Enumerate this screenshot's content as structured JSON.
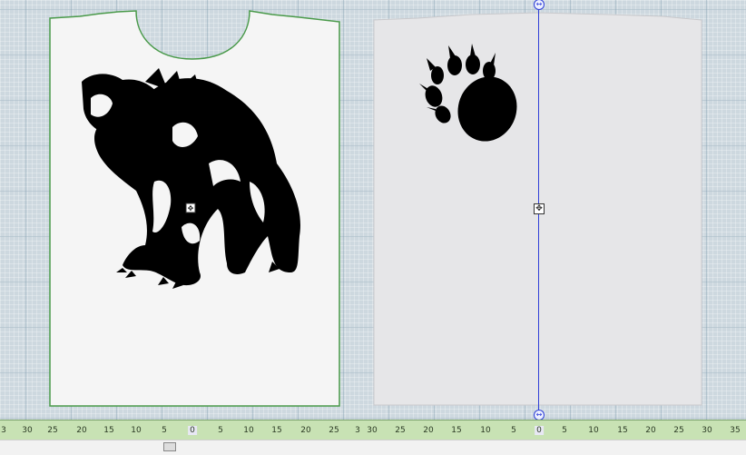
{
  "ruler": {
    "labels": [
      "3",
      "30",
      "25",
      "20",
      "15",
      "10",
      "5",
      "0",
      "5",
      "10",
      "15",
      "20",
      "25",
      "3",
      "30",
      "25",
      "20",
      "15",
      "10",
      "5",
      "0",
      "5",
      "10",
      "15",
      "20",
      "25",
      "30",
      "35"
    ]
  },
  "colors": {
    "front_fill": "#f5f5f5",
    "front_outline": "#4a9a4a",
    "back_fill": "#e6e6e8",
    "guide_line": "#2f3fd8",
    "ruler_bg": "#c8e2b4",
    "motif": "#000000"
  },
  "icons": {
    "bear": "roaring-bear-motif",
    "paw": "bear-paw-motif",
    "move": "move-handle-icon",
    "resize": "horizontal-resize-icon"
  }
}
